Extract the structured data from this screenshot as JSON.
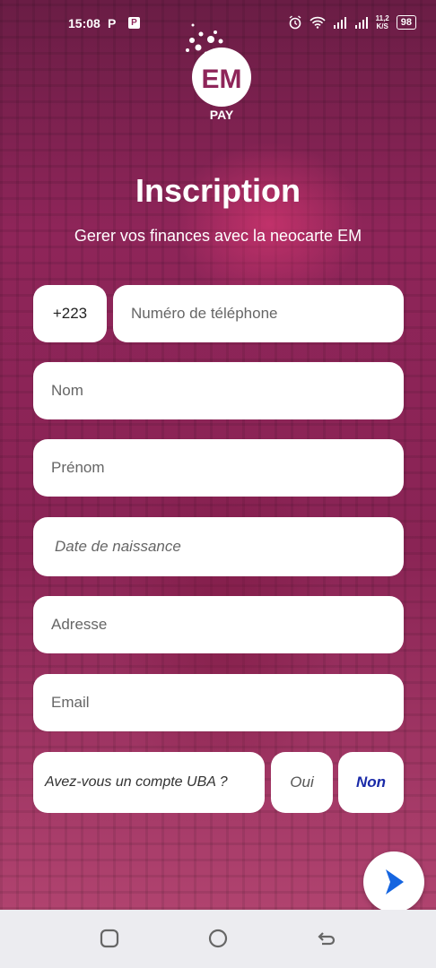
{
  "status_bar": {
    "time": "15:08",
    "notif_p": "P",
    "notif_p2": "P",
    "speed_top": "11,2",
    "speed_bottom": "K/S",
    "battery": "98"
  },
  "logo": {
    "mark": "EM",
    "label": "PAY"
  },
  "header": {
    "title": "Inscription",
    "subtitle": "Gerer vos finances avec la neocarte EM"
  },
  "form": {
    "country_code": "+223",
    "phone_placeholder": "Numéro de téléphone",
    "nom_placeholder": "Nom",
    "prenom_placeholder": "Prénom",
    "dob_placeholder": "Date de naissance",
    "adresse_placeholder": "Adresse",
    "email_placeholder": "Email",
    "uba_question": "Avez-vous un compte UBA ?",
    "uba_yes": "Oui",
    "uba_no": "Non"
  },
  "icons": {
    "next": "chevron-right-icon",
    "nav_recent": "square-icon",
    "nav_home": "circle-icon",
    "nav_back": "back-icon"
  },
  "colors": {
    "brand": "#8e2559",
    "next_arrow": "#1565e0",
    "selected_option": "#1a2aa8"
  }
}
